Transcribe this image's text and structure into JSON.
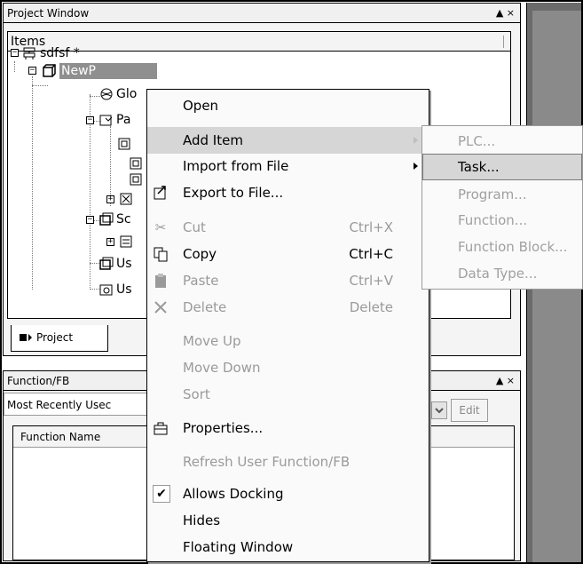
{
  "project_window": {
    "title": "Project Window",
    "controls": "▲ ×",
    "items_header": "Items",
    "tree": {
      "root": "sdfsf *",
      "project_node": "NewP",
      "children": [
        "Glo",
        "Pa",
        "Sc",
        "Us",
        "Us"
      ]
    },
    "tab_label": "Project"
  },
  "function_fb": {
    "title": "Function/FB",
    "controls": "▲ ×",
    "combo_value": "Most Recently Usec",
    "edit_label": "Edit",
    "column_header": "Function Name"
  },
  "context_menu": {
    "items": [
      {
        "label": "Open",
        "shortcut": "",
        "enabled": true
      },
      {
        "label": "Add Item",
        "shortcut": "",
        "enabled": true,
        "submenu": true,
        "highlighted": true
      },
      {
        "label": "Import from File",
        "shortcut": "",
        "enabled": true,
        "submenu": true
      },
      {
        "label": "Export to File...",
        "shortcut": "",
        "enabled": true
      },
      {
        "label": "Cut",
        "shortcut": "Ctrl+X",
        "enabled": false
      },
      {
        "label": "Copy",
        "shortcut": "Ctrl+C",
        "enabled": true
      },
      {
        "label": "Paste",
        "shortcut": "Ctrl+V",
        "enabled": false
      },
      {
        "label": "Delete",
        "shortcut": "Delete",
        "enabled": false
      },
      {
        "label": "Move Up",
        "shortcut": "",
        "enabled": false
      },
      {
        "label": "Move Down",
        "shortcut": "",
        "enabled": false
      },
      {
        "label": "Sort",
        "shortcut": "",
        "enabled": false
      },
      {
        "label": "Properties...",
        "shortcut": "",
        "enabled": true
      },
      {
        "label": "Refresh User Function/FB",
        "shortcut": "",
        "enabled": false
      },
      {
        "label": "Allows Docking",
        "shortcut": "",
        "enabled": true,
        "checked": true
      },
      {
        "label": "Hides",
        "shortcut": "",
        "enabled": true
      },
      {
        "label": "Floating Window",
        "shortcut": "",
        "enabled": true
      }
    ]
  },
  "submenu": {
    "items": [
      {
        "label": "PLC...",
        "enabled": false
      },
      {
        "label": "Task...",
        "enabled": true,
        "highlighted": true
      },
      {
        "label": "Program...",
        "enabled": false
      },
      {
        "label": "Function...",
        "enabled": false
      },
      {
        "label": "Function Block...",
        "enabled": false
      },
      {
        "label": "Data Type...",
        "enabled": false
      }
    ]
  },
  "icons": {
    "export": "export-icon",
    "cut": "scissors-icon",
    "copy": "copy-icon",
    "paste": "paste-icon",
    "delete": "delete-x-icon",
    "properties": "properties-icon",
    "check": "checkmark-icon"
  },
  "colors": {
    "highlight": "#d6d6d6",
    "disabled_text": "#9a9a9a",
    "dark_area": "#6b6b6b"
  }
}
